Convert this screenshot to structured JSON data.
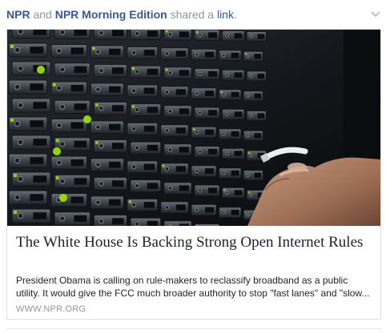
{
  "post": {
    "actor_1": "NPR",
    "connector": "and",
    "actor_2": "NPR Morning Edition",
    "action": "shared a",
    "action_object": "link",
    "action_end": "."
  },
  "options_icon": "chevron-down-icon",
  "link_card": {
    "image_icon": "server-rack-photo",
    "title": "The White House Is Backing Strong Open Internet Rules",
    "description_line_1": "President Obama is calling on rule-makers to reclassify broadband as a public",
    "description_line_2": "utility. It would give the FCC much broader authority to stop \"fast lanes\" and \"slow...",
    "source": "WWW.NPR.ORG"
  },
  "colors": {
    "link_blue": "#365899",
    "meta_gray": "#90949c",
    "text": "#1d2129",
    "border": "#dddfe2",
    "server_led_green": "#9be000"
  }
}
